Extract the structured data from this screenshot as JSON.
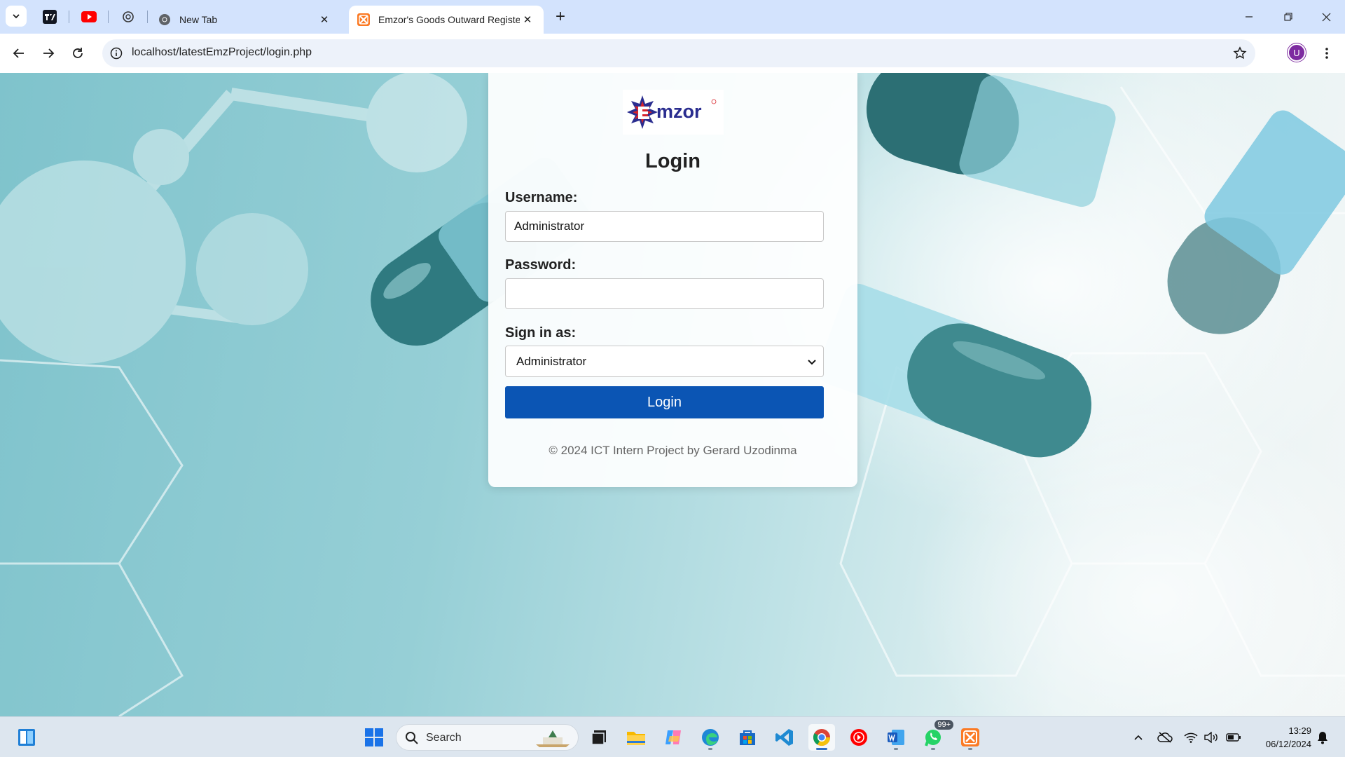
{
  "browser": {
    "tabs": [
      {
        "title": "New Tab",
        "active": false
      },
      {
        "title": "Emzor's Goods Outward Register",
        "active": true
      }
    ],
    "address": "localhost/latestEmzProject/login.php",
    "profile_initial": "U"
  },
  "login_page": {
    "logo_text": "mzor",
    "title": "Login",
    "username_label": "Username:",
    "username_value": "Administrator",
    "password_label": "Password:",
    "password_value": "",
    "role_label": "Sign in as:",
    "role_selected": "Administrator",
    "submit_label": "Login",
    "footer": "© 2024 ICT Intern Project by Gerard Uzodinma"
  },
  "taskbar": {
    "search_placeholder": "Search",
    "whatsapp_badge": "99+",
    "time": "13:29",
    "date": "06/12/2024"
  },
  "colors": {
    "primary_button": "#0b55b4",
    "tab_strip": "#d3e3fd",
    "logo_red": "#d8232a",
    "logo_blue": "#2a2d8f"
  }
}
